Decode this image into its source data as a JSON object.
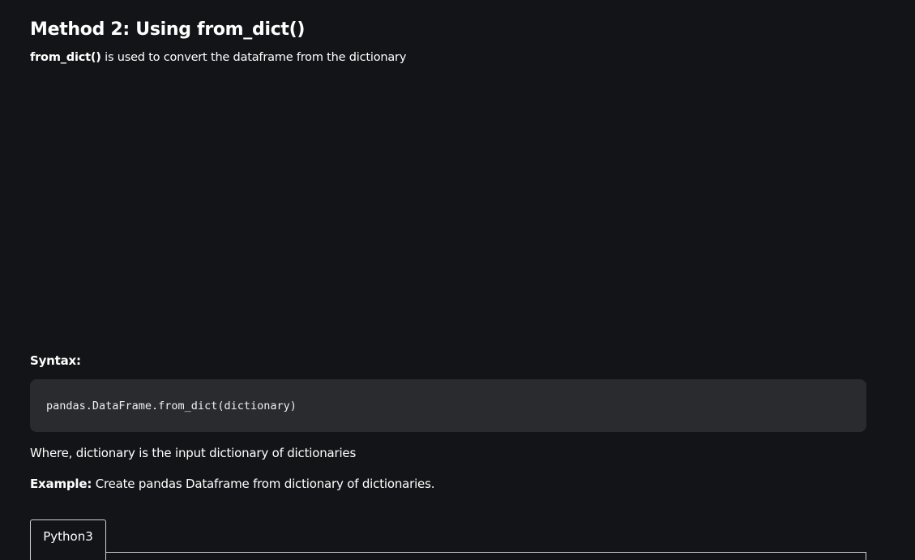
{
  "heading": "Method 2: Using from_dict()",
  "intro": {
    "term": "from_dict()",
    "text": " is used to convert the dataframe from the dictionary"
  },
  "syntax_label": "Syntax:",
  "code": "pandas.DataFrame.from_dict(dictionary)",
  "where_text": "Where, dictionary is the input dictionary of dictionaries",
  "example": {
    "label": "Example:",
    "text": " Create pandas Dataframe from dictionary of dictionaries."
  },
  "tabs": [
    {
      "label": "Python3",
      "active": true
    }
  ]
}
